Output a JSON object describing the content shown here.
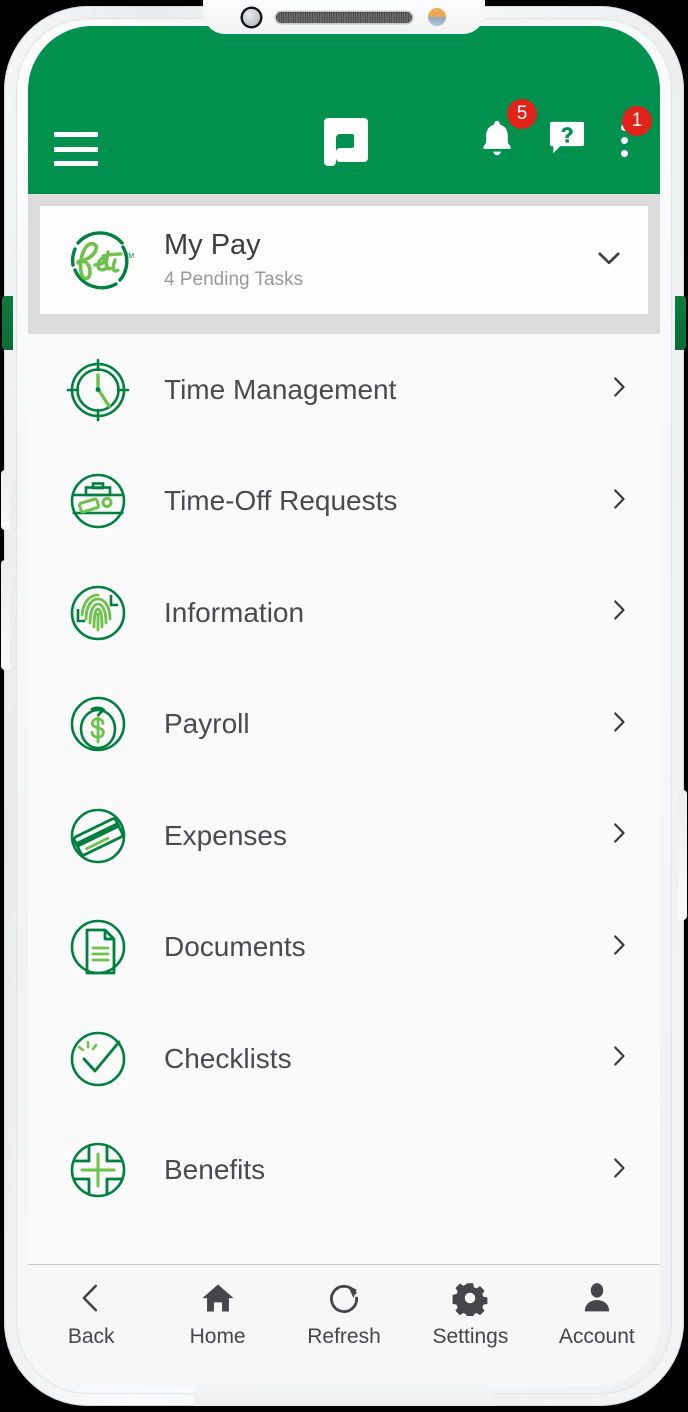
{
  "colors": {
    "brand_green": "#00914e",
    "icon_dark_green": "#00803f",
    "icon_light_green": "#6cc24a",
    "badge_red": "#e2231a",
    "text_dark": "#4a4a4f",
    "text_muted": "#9a9a9e"
  },
  "header": {
    "menu_button": "menu",
    "logo": "paylocity-logo",
    "notifications": {
      "icon": "bell-icon",
      "badge": "5"
    },
    "help": {
      "icon": "help-chat-icon"
    },
    "overflow": {
      "icon": "kebab-menu-icon",
      "badge": "1"
    }
  },
  "card": {
    "logo": "beti-logo",
    "logo_text": "Beti",
    "trademark": "TM",
    "title": "My Pay",
    "subtitle": "4 Pending Tasks",
    "chevron": "chevron-down-icon"
  },
  "menu": {
    "items": [
      {
        "label": "Time Management",
        "icon": "clock-icon"
      },
      {
        "label": "Time-Off Requests",
        "icon": "briefcase-beach-icon"
      },
      {
        "label": "Information",
        "icon": "fingerprint-icon"
      },
      {
        "label": "Payroll",
        "icon": "money-bag-icon"
      },
      {
        "label": "Expenses",
        "icon": "credit-card-icon"
      },
      {
        "label": "Documents",
        "icon": "document-icon"
      },
      {
        "label": "Checklists",
        "icon": "check-circle-icon"
      },
      {
        "label": "Benefits",
        "icon": "medical-cross-icon"
      }
    ]
  },
  "bottom_nav": {
    "items": [
      {
        "label": "Back",
        "icon": "chevron-left-icon"
      },
      {
        "label": "Home",
        "icon": "home-icon"
      },
      {
        "label": "Refresh",
        "icon": "refresh-icon"
      },
      {
        "label": "Settings",
        "icon": "gear-icon"
      },
      {
        "label": "Account",
        "icon": "person-icon"
      }
    ]
  }
}
